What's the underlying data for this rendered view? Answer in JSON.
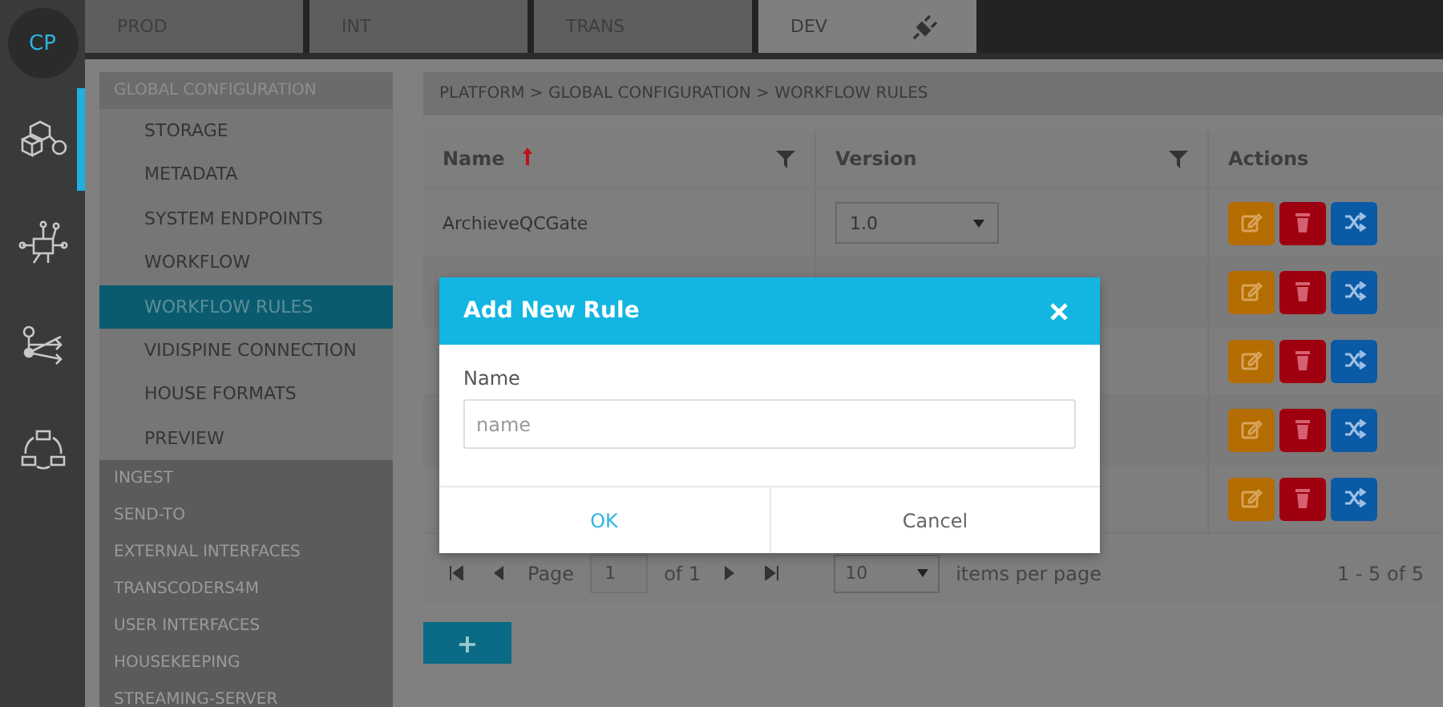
{
  "app": {
    "logo": "CP"
  },
  "rail": [
    {
      "kind": "modules",
      "selected": true
    },
    {
      "kind": "network",
      "selected": false
    },
    {
      "kind": "routing",
      "selected": false
    },
    {
      "kind": "cycle",
      "selected": false
    }
  ],
  "environments": [
    {
      "label": "PROD",
      "selected": false,
      "connected": false
    },
    {
      "label": "INT",
      "selected": false,
      "connected": false
    },
    {
      "label": "TRANS",
      "selected": false,
      "connected": false
    },
    {
      "label": "DEV",
      "selected": true,
      "connected": true
    }
  ],
  "sidebar": [
    {
      "label": "GLOBAL CONFIGURATION",
      "expanded": true,
      "children": [
        {
          "label": "STORAGE",
          "selected": false
        },
        {
          "label": "METADATA",
          "selected": false
        },
        {
          "label": "SYSTEM ENDPOINTS",
          "selected": false
        },
        {
          "label": "WORKFLOW",
          "selected": false
        },
        {
          "label": "WORKFLOW RULES",
          "selected": true
        },
        {
          "label": "VIDISPINE CONNECTION",
          "selected": false
        },
        {
          "label": "HOUSE FORMATS",
          "selected": false
        },
        {
          "label": "PREVIEW",
          "selected": false
        }
      ]
    },
    {
      "label": "INGEST",
      "expanded": false
    },
    {
      "label": "SEND-TO",
      "expanded": false
    },
    {
      "label": "EXTERNAL INTERFACES",
      "expanded": false
    },
    {
      "label": "TRANSCODERS4M",
      "expanded": false
    },
    {
      "label": "USER INTERFACES",
      "expanded": false
    },
    {
      "label": "HOUSEKEEPING",
      "expanded": false
    },
    {
      "label": "STREAMING-SERVER",
      "expanded": false
    }
  ],
  "breadcrumb": "PLATFORM > GLOBAL CONFIGURATION > WORKFLOW RULES",
  "table": {
    "columns": [
      {
        "label": "Name",
        "sorted": true,
        "filter": true
      },
      {
        "label": "Version",
        "filter": true
      },
      {
        "label": "Actions",
        "filter": false
      }
    ],
    "rows": [
      {
        "name": "ArchieveQCGate",
        "version": "1.0",
        "actions": [
          {
            "kind": "edit"
          },
          {
            "kind": "delete"
          },
          {
            "kind": "shuffle"
          }
        ]
      },
      {
        "actions": [
          {
            "kind": "edit"
          },
          {
            "kind": "delete"
          },
          {
            "kind": "shuffle"
          }
        ]
      },
      {
        "actions": [
          {
            "kind": "edit"
          },
          {
            "kind": "delete"
          },
          {
            "kind": "shuffle"
          }
        ]
      },
      {
        "actions": [
          {
            "kind": "edit"
          },
          {
            "kind": "delete"
          },
          {
            "kind": "shuffle"
          }
        ]
      },
      {
        "actions": [
          {
            "kind": "edit"
          },
          {
            "kind": "delete"
          },
          {
            "kind": "shuffle"
          }
        ]
      }
    ]
  },
  "pagination": {
    "page_label": "Page",
    "page": "1",
    "page_count": "of 1",
    "page_size": "10",
    "page_size_label": "items per page",
    "summary": "1 - 5 of 5"
  },
  "add_button": {
    "label": "+"
  },
  "dialog": {
    "title": "Add New Rule",
    "field_label": "Name",
    "placeholder": "name",
    "buttons": [
      {
        "label": "OK",
        "kind": "primary"
      },
      {
        "label": "Cancel",
        "kind": "secondary"
      }
    ]
  }
}
